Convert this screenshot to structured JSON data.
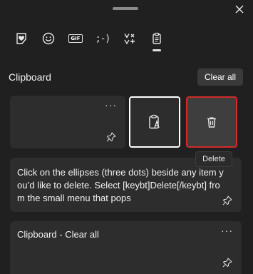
{
  "window": {
    "close_icon": "close-icon"
  },
  "tabs": [
    {
      "name": "tab-favorites",
      "icon": "heart-sticker-icon"
    },
    {
      "name": "tab-emoji",
      "icon": "smiley-icon"
    },
    {
      "name": "tab-gif",
      "icon": "gif-icon",
      "label": "GIF"
    },
    {
      "name": "tab-kaomoji",
      "icon": "kaomoji-icon",
      "label": ";-)"
    },
    {
      "name": "tab-symbols",
      "icon": "symbols-icon"
    },
    {
      "name": "tab-clipboard",
      "icon": "clipboard-icon",
      "active": true
    }
  ],
  "clipboard": {
    "title": "Clipboard",
    "clear_all_label": "Clear all",
    "items": [
      {
        "text": "",
        "more": "···"
      },
      {
        "text": "Click on the ellipses (three dots) beside any item you’d like to delete. Select [keybt]Delete[/keybt] from the small menu that pops",
        "more": "···"
      },
      {
        "text": "Clipboard - Clear all",
        "more": "···"
      }
    ],
    "tooltip": "Delete"
  },
  "colors": {
    "background": "#202020",
    "card": "#2d2d2d",
    "delete_outline": "#d42a2a"
  }
}
